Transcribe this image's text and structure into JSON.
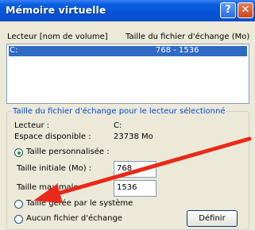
{
  "window": {
    "title": "Mémoire virtuelle",
    "help_label": "?",
    "close_label": "✕"
  },
  "list": {
    "col_drive": "Lecteur [nom de volume]",
    "col_size": "Taille du fichier d'échange (Mo)",
    "rows": [
      {
        "drive": "C:",
        "size": "768 - 1536",
        "selected": true
      }
    ]
  },
  "group": {
    "title": "Taille du fichier d'échange pour le lecteur sélectionné",
    "drive_label": "Lecteur :",
    "drive_value": "C:",
    "space_label": "Espace disponible :",
    "space_value": "23738 Mo"
  },
  "options": {
    "custom_label": "Taille personnalisée :",
    "initial_label": "Taille initiale (Mo) :",
    "initial_value": "768",
    "max_label": "Taille maximale",
    "max_value": "1536",
    "system_label": "Taille gérée par le système",
    "none_label": "Aucun fichier d'échange",
    "selected": "custom"
  },
  "buttons": {
    "set_label": "Définir"
  },
  "colors": {
    "title_bar": "#0553d6",
    "group_title": "#0046d5",
    "selection": "#316ac5",
    "arrow": "#e8291c"
  }
}
